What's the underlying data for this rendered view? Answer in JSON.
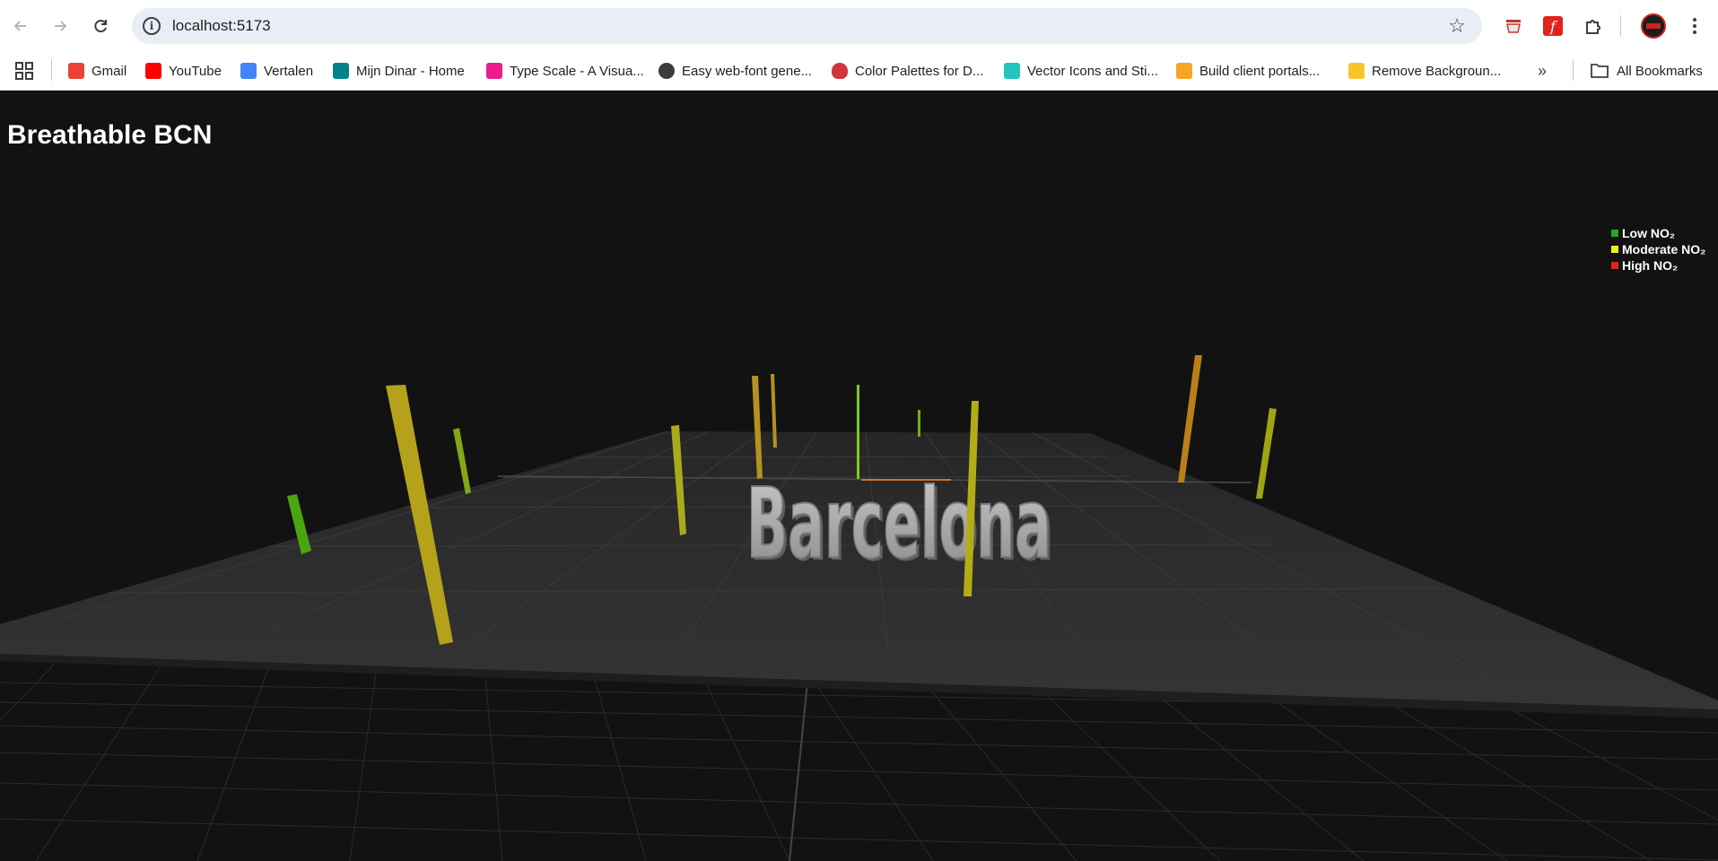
{
  "browser": {
    "url": "localhost:5173",
    "bookmarks": [
      {
        "label": "Gmail",
        "icon": "gmail-icon",
        "color": "#ea4335"
      },
      {
        "label": "YouTube",
        "icon": "youtube-icon",
        "color": "#ff0000"
      },
      {
        "label": "Vertalen",
        "icon": "translate-icon",
        "color": "#4285f4"
      },
      {
        "label": "Mijn Dinar - Home",
        "icon": "sharepoint-icon",
        "color": "#038387"
      },
      {
        "label": "Type Scale - A Visua...",
        "icon": "typescale-icon",
        "color": "#e91e8c"
      },
      {
        "label": "Easy web-font gene...",
        "icon": "fontsquirrel-icon",
        "color": "#3c3c3c"
      },
      {
        "label": "Color Palettes for D...",
        "icon": "colorhunt-icon",
        "color": "#d0343c"
      },
      {
        "label": "Vector Icons and Sti...",
        "icon": "flaticon-icon",
        "color": "#23c4c0"
      },
      {
        "label": "Build client portals...",
        "icon": "portal-icon",
        "color": "#f5a623"
      },
      {
        "label": "Remove Backgroun...",
        "icon": "removebg-icon",
        "color": "#f7c52b"
      }
    ],
    "all_bookmarks_label": "All Bookmarks"
  },
  "app": {
    "title": "Breathable BCN",
    "scene_text": "Barcelona",
    "legend": [
      {
        "label": "Low NO₂",
        "color": "#22aa22"
      },
      {
        "label": "Moderate NO₂",
        "color": "#eeee22"
      },
      {
        "label": "High NO₂",
        "color": "#dd2222"
      }
    ]
  }
}
